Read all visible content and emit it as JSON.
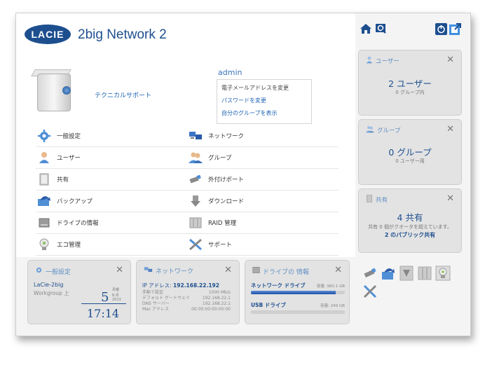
{
  "header": {
    "logo_text": "LACIE",
    "product_name": "2big Network 2"
  },
  "device": {
    "tech_support_label": "テクニカルサポート"
  },
  "user_panel": {
    "username": "admin",
    "items": [
      "電子メールアドレスを変更",
      "パスワードを変更",
      "自分のグループを表示"
    ]
  },
  "menu": {
    "items": [
      {
        "label": "一般設定",
        "icon": "gear-icon"
      },
      {
        "label": "ネットワーク",
        "icon": "network-icon"
      },
      {
        "label": "ユーザー",
        "icon": "user-icon"
      },
      {
        "label": "グループ",
        "icon": "group-icon"
      },
      {
        "label": "共有",
        "icon": "share-icon"
      },
      {
        "label": "外付けポート",
        "icon": "usb-icon"
      },
      {
        "label": "バックアップ",
        "icon": "backup-icon"
      },
      {
        "label": "ダウンロード",
        "icon": "download-icon"
      },
      {
        "label": "ドライブの情報",
        "icon": "drive-icon"
      },
      {
        "label": "RAID 管理",
        "icon": "raid-icon"
      },
      {
        "label": "エコ管理",
        "icon": "eco-icon"
      },
      {
        "label": "サポート",
        "icon": "support-icon"
      }
    ]
  },
  "sidebar": {
    "users_widget": {
      "title": "ユーザー",
      "count": "2 ユーザー",
      "detail": "0 グループ内"
    },
    "groups_widget": {
      "title": "グループ",
      "count": "0 グループ",
      "detail": "0 ユーザー用"
    },
    "shares_widget": {
      "title": "共有",
      "count": "4 共有",
      "detail": "共有 0 個がクオータを超えています。",
      "link": "2 のパブリック共有"
    }
  },
  "general_widget": {
    "title": "一般設定",
    "device_name": "LaCie-2big",
    "workgroup": "Workgroup 上",
    "day": "5",
    "day_of_week": "月曜",
    "month": "8 月",
    "year": "2013",
    "time": "17:14"
  },
  "network_widget": {
    "title": "ネットワーク",
    "ip_label": "IP アドレス:",
    "ip_value": "192.168.22.192",
    "rows": [
      {
        "label": "手動で設定",
        "value": "1000 Mb/s"
      },
      {
        "label": "デフォルト ゲートウェイ",
        "value": "192.168.22.1"
      },
      {
        "label": "DNS サーバー",
        "value": "192.168.22.1"
      },
      {
        "label": "Mac アドレス",
        "value": "00:00:00:00:00:00"
      }
    ]
  },
  "drive_widget": {
    "title": "ドライブの 情報",
    "drives": [
      {
        "name": "ネットワーク ドライブ",
        "capacity": "容量: 980.1 GB",
        "used_fraction": 0.9
      },
      {
        "name": "USB ドライブ",
        "capacity": "容量: 249 GB",
        "used_fraction": 0.0
      }
    ]
  },
  "colors": {
    "accent": "#1d4f8f",
    "link": "#1d63b3",
    "widget_bg": "#e3e3e3"
  }
}
